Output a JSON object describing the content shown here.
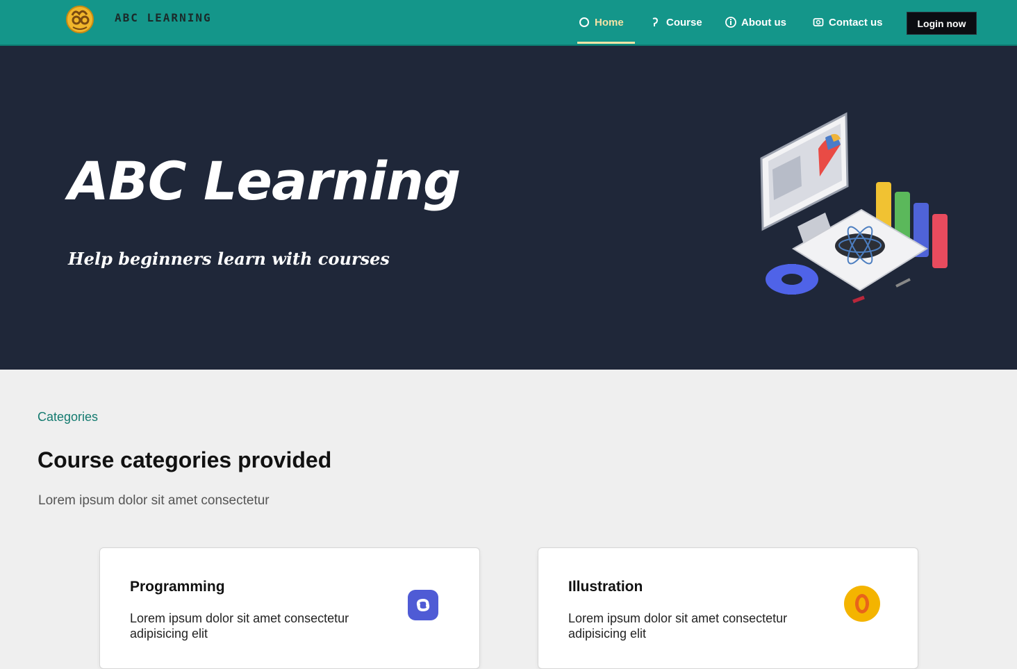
{
  "nav": {
    "brand": "ABC LEARNING",
    "items": [
      {
        "label": "Home",
        "icon": "home-icon"
      },
      {
        "label": "Course",
        "icon": "book-icon"
      },
      {
        "label": "About us",
        "icon": "info-icon"
      },
      {
        "label": "Contact us",
        "icon": "contact-icon"
      }
    ],
    "login_label": "Login now"
  },
  "hero": {
    "title": "ABC Learning",
    "subtitle": "Help beginners learn with courses"
  },
  "section": {
    "eyebrow": "Categories",
    "title": "Course categories provided",
    "description": "Lorem ipsum dolor sit amet consectetur"
  },
  "cards": [
    {
      "title": "Programming",
      "description": "Lorem ipsum dolor sit amet consectetur adipisicing elit",
      "icon": "code-icon",
      "icon_color": "#4f5bd5"
    },
    {
      "title": "Illustration",
      "description": "Lorem ipsum dolor sit amet consectetur adipisicing elit",
      "icon": "coin-icon",
      "icon_color": "#f4b400"
    }
  ],
  "colors": {
    "nav_bg": "#14968a",
    "hero_bg": "#1f2739",
    "page_bg": "#efefef",
    "accent": "#f4e3a6"
  }
}
